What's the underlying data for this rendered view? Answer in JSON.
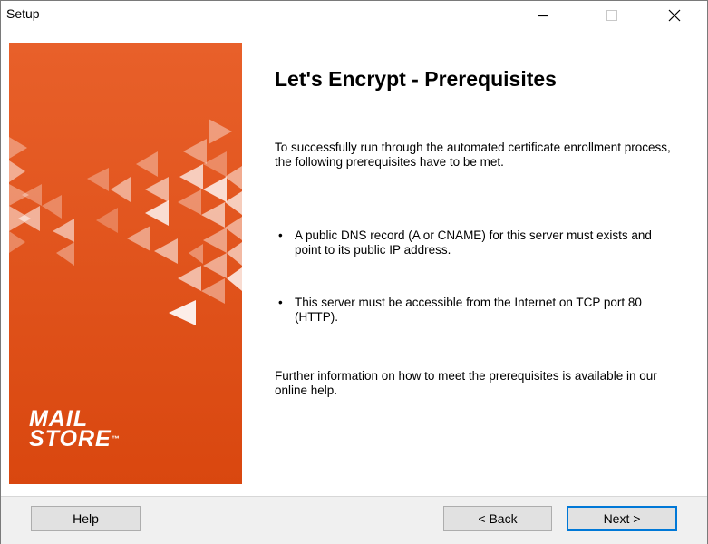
{
  "window": {
    "title": "Setup"
  },
  "titlebar": {
    "minimize_icon": "minimize-icon",
    "maximize_icon": "maximize-icon",
    "close_icon": "close-icon"
  },
  "sidebar": {
    "brand_color": "#e5541f",
    "logo_line1": "MAIL",
    "logo_line2": "STORE",
    "logo_tm": "™"
  },
  "main": {
    "heading": "Let's Encrypt - Prerequisites",
    "intro": "To successfully run through the automated certificate enrollment process, the following prerequisites have to be met.",
    "bullets": [
      "A public DNS record (A or CNAME) for this server must exists and point to its public IP address.",
      "This server must be accessible from the Internet on TCP port 80 (HTTP)."
    ],
    "bullet_glyph": "•",
    "footer_text": "Further information on how to meet the prerequisites is available in our online help."
  },
  "buttons": {
    "help": "Help",
    "back": "< Back",
    "next": "Next >"
  }
}
